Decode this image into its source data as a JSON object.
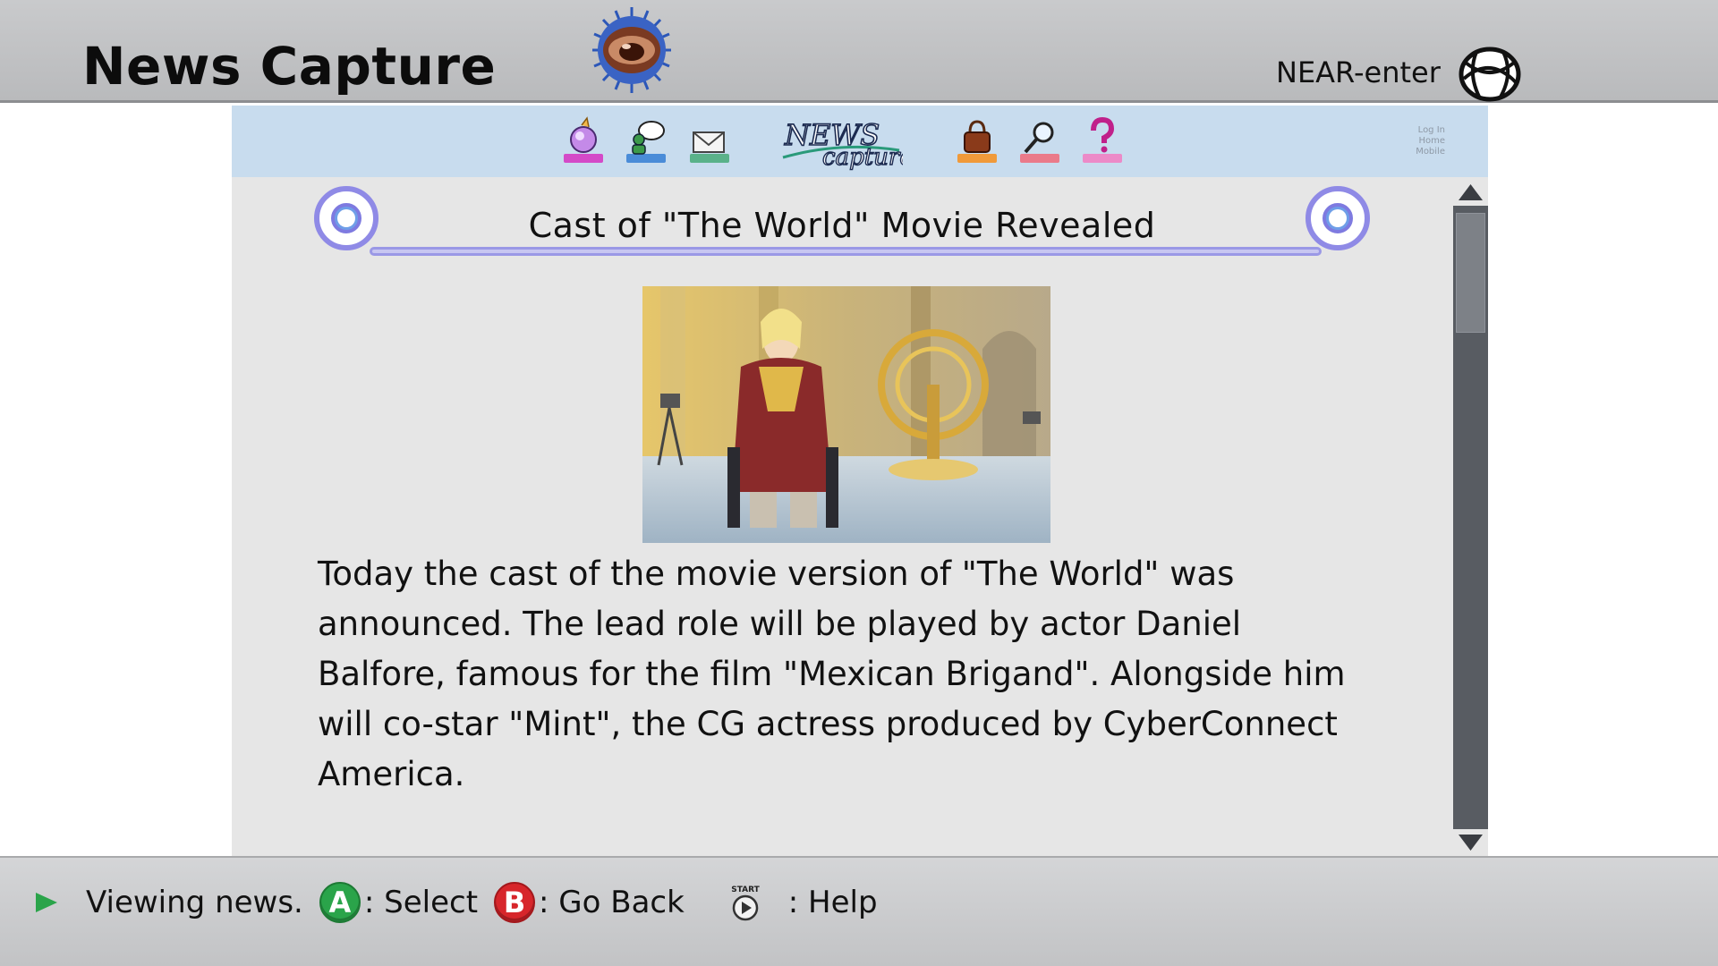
{
  "header": {
    "title": "News Capture",
    "network_label": "NEAR-enter"
  },
  "site_nav": {
    "logo_text_top": "NEWS",
    "logo_text_bottom": "capture",
    "mini_links": [
      "Log In",
      "Home",
      "Mobile"
    ],
    "icons": [
      "globe-sphere-icon",
      "person-chat-icon",
      "mail-icon",
      "bag-icon",
      "magnifier-icon",
      "question-icon"
    ]
  },
  "article": {
    "title": "Cast of \"The World\" Movie Revealed",
    "body": "Today the cast of the movie version of \"The World\" was announced. The lead role will be played by actor Daniel Balfore, famous for the film \"Mexican Brigand\". Alongside him will co-star \"Mint\", the CG actress produced by CyberConnect America."
  },
  "status": {
    "message": "Viewing news.",
    "a_key": "A",
    "a_action": ": Select",
    "b_key": "B",
    "b_action": ": Go Back",
    "start_label": "START",
    "start_action": ": Help"
  },
  "colors": {
    "accent_ring": "#8f8ae6",
    "nav_strip": "#c8dcee",
    "a_button": "#2aa44a",
    "b_button": "#d7262b"
  }
}
